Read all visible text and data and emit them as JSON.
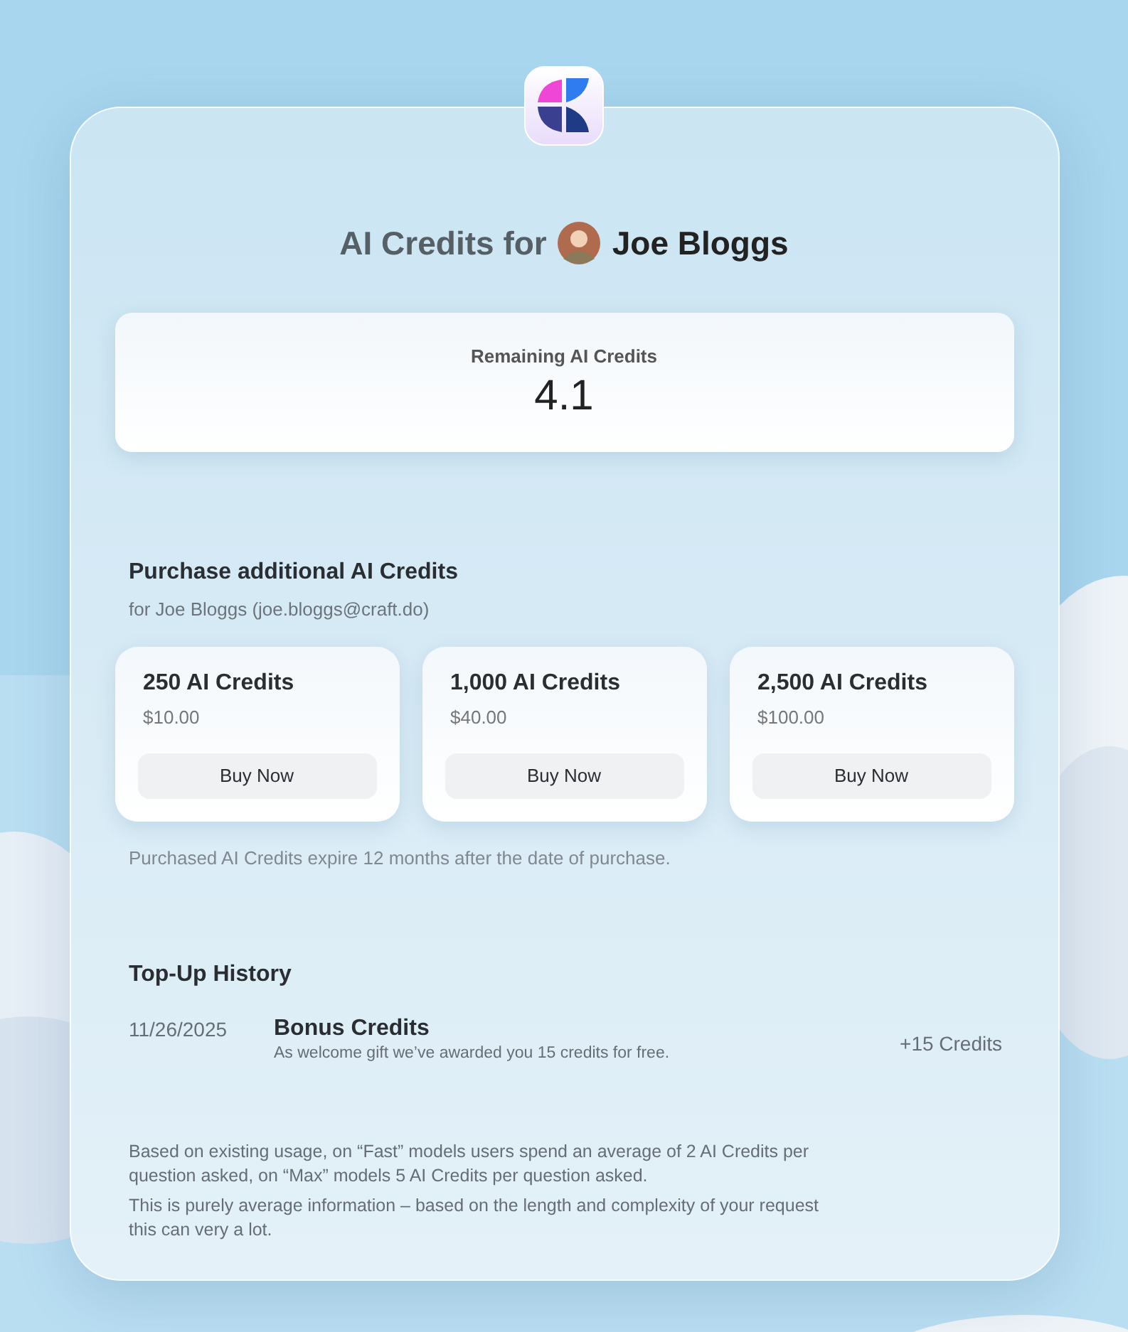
{
  "header": {
    "title_prefix": "AI Credits for",
    "user_name": "Joe Bloggs"
  },
  "balance": {
    "label": "Remaining AI Credits",
    "value": "4.1"
  },
  "purchase": {
    "title": "Purchase additional AI Credits",
    "subtitle": "for Joe Bloggs (joe.bloggs@craft.do)",
    "packages": [
      {
        "name": "250 AI Credits",
        "price": "$10.00",
        "button": "Buy Now"
      },
      {
        "name": "1,000 AI Credits",
        "price": "$40.00",
        "button": "Buy Now"
      },
      {
        "name": "2,500 AI Credits",
        "price": "$100.00",
        "button": "Buy Now"
      }
    ],
    "note": "Purchased AI Credits expire 12 months after the date of purchase."
  },
  "history": {
    "title": "Top-Up History",
    "entries": [
      {
        "date": "11/26/2025",
        "title": "Bonus Credits",
        "description": "As welcome gift we’ve awarded you 15 credits for free.",
        "amount": "+15 Credits"
      }
    ]
  },
  "footer": [
    "Based on existing usage, on “Fast” models users spend an average of 2 AI Credits per question asked, on “Max” models 5 AI Credits per question asked.",
    "This is purely average information – based on the length and complexity of your request this can very a lot."
  ]
}
